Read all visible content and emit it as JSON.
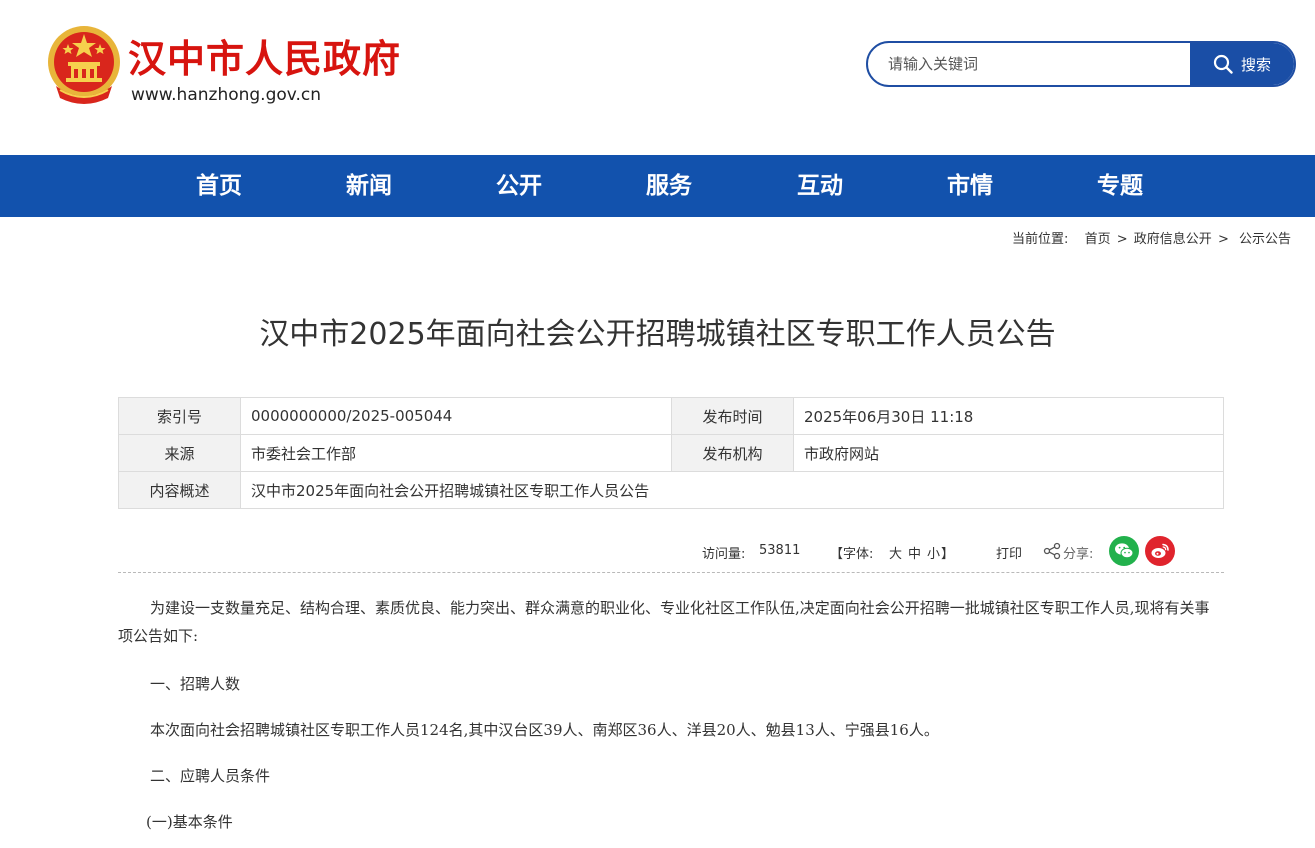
{
  "header": {
    "site_title": "汉中市人民政府",
    "site_url": "www.hanzhong.gov.cn",
    "search_placeholder": "请输入关键词",
    "search_button": "搜索"
  },
  "nav": {
    "items": [
      "首页",
      "新闻",
      "公开",
      "服务",
      "互动",
      "市情",
      "专题"
    ]
  },
  "breadcrumb": {
    "prefix": "当前位置:",
    "items": [
      "首页",
      "政府信息公开",
      "公示公告"
    ],
    "separator": ">"
  },
  "article": {
    "title": "汉中市2025年面向社会公开招聘城镇社区专职工作人员公告",
    "meta": {
      "index_label": "索引号",
      "index_value": "0000000000/2025-005044",
      "publish_time_label": "发布时间",
      "publish_time_value": "2025年06月30日 11:18",
      "source_label": "来源",
      "source_value": "市委社会工作部",
      "publisher_label": "发布机构",
      "publisher_value": "市政府网站",
      "summary_label": "内容概述",
      "summary_value": "汉中市2025年面向社会公开招聘城镇社区专职工作人员公告"
    },
    "tools": {
      "visits_label": "访问量:",
      "visits_value": "53811",
      "font_size_label": "【字体:",
      "font_large": "大",
      "font_medium": "中",
      "font_small": "小",
      "font_size_close": "】",
      "print_label": "打印",
      "share_label": "分享:"
    },
    "body": {
      "p1": "为建设一支数量充足、结构合理、素质优良、能力突出、群众满意的职业化、专业化社区工作队伍,决定面向社会公开招聘一批城镇社区专职工作人员,现将有关事项公告如下:",
      "p2": "一、招聘人数",
      "p3": "本次面向社会招聘城镇社区专职工作人员124名,其中汉台区39人、南郑区36人、洋县20人、勉县13人、宁强县16人。",
      "p4": "二、应聘人员条件",
      "p5": "(一)基本条件"
    }
  },
  "colors": {
    "brand_red": "#d7140f",
    "nav_blue": "#1252ad",
    "search_blue": "#1a4ea6",
    "wechat_green": "#22b14c",
    "weibo_red": "#e0242d"
  },
  "icons": [
    "national-emblem-icon",
    "search-icon",
    "share-icon",
    "wechat-icon",
    "weibo-icon"
  ]
}
